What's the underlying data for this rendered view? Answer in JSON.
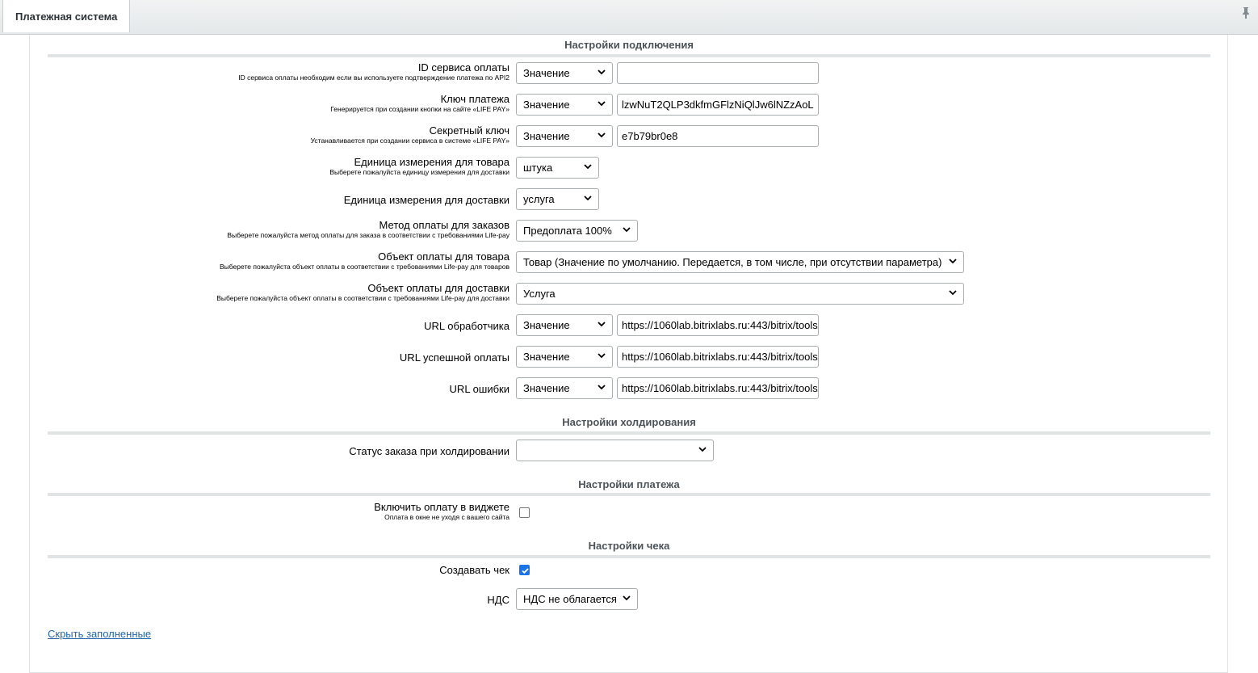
{
  "header": {
    "tab_label": "Платежная система"
  },
  "sections": {
    "connection": "Настройки подключения",
    "holding": "Настройки холдирования",
    "payment": "Настройки платежа",
    "receipt": "Настройки чека"
  },
  "fields": {
    "service_id": {
      "label": "ID сервиса оплаты",
      "hint": "ID сервиса оплаты необходим если вы используете подтверждение платежа по API2",
      "type": "Значение",
      "value": ""
    },
    "payment_key": {
      "label": "Ключ платежа",
      "hint": "Генерируется при создании кнопки на сайте «LIFE PAY»",
      "type": "Значение",
      "value": "lzwNuT2QLP3dkfmGFlzNiQlJw6lNZzAoL"
    },
    "secret_key": {
      "label": "Секретный ключ",
      "hint": "Устанавливается при создании сервиса в системе «LIFE PAY»",
      "type": "Значение",
      "value": "e7b79br0e8"
    },
    "item_unit": {
      "label": "Единица измерения для товара",
      "hint": "Выберете пожалуйста единицу измерения для доставки",
      "value": "штука"
    },
    "delivery_unit": {
      "label": "Единица измерения для доставки",
      "value": "услуга"
    },
    "payment_method": {
      "label": "Метод оплаты для заказов",
      "hint": "Выберете пожалуйста метод оплаты для заказа в соответствии с требованиями Life-pay",
      "value": "Предоплата 100%"
    },
    "item_object": {
      "label": "Объект оплаты для товара",
      "hint": "Выберете пожалуйста объект оплаты в соответствии с требованиями Life-pay для товаров",
      "value": "Товар (Значение по умолчанию. Передается, в том числе, при отсутствии параметра)"
    },
    "delivery_object": {
      "label": "Объект оплаты для доставки",
      "hint": "Выберете пожалуйста объект оплаты в соответствии с требованиями Life-pay для доставки",
      "value": "Услуга"
    },
    "handler_url": {
      "label": "URL обработчика",
      "type": "Значение",
      "value": "https://1060lab.bitrixlabs.ru:443/bitrix/tools/"
    },
    "success_url": {
      "label": "URL успешной оплаты",
      "type": "Значение",
      "value": "https://1060lab.bitrixlabs.ru:443/bitrix/tools/"
    },
    "error_url": {
      "label": "URL ошибки",
      "type": "Значение",
      "value": "https://1060lab.bitrixlabs.ru:443/bitrix/tools/"
    },
    "hold_status": {
      "label": "Статус заказа при холдировании",
      "value": ""
    },
    "widget_payment": {
      "label": "Включить оплату в виджете",
      "hint": "Оплата в окне не уходя с вашего сайта",
      "checked": false
    },
    "create_receipt": {
      "label": "Создавать чек",
      "checked": true
    },
    "vat": {
      "label": "НДС",
      "value": "НДС не облагается"
    }
  },
  "footer": {
    "hide_filled_link": "Скрыть заполненные"
  },
  "icons": {
    "pin": "pin-icon",
    "chevron": "chevron-down-icon",
    "check": "checkmark-icon"
  },
  "colors": {
    "link": "#2067b0",
    "checkbox_checked": "#1a73e8"
  }
}
